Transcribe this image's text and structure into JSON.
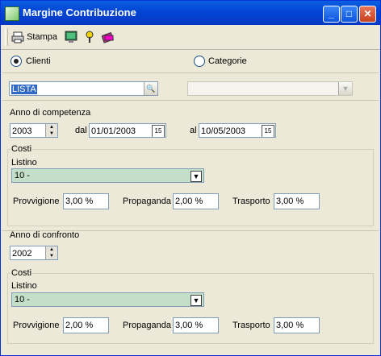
{
  "window": {
    "title": "Margine Contribuzione"
  },
  "toolbar": {
    "print_label": "Stampa"
  },
  "mode": {
    "clienti_label": "Clienti",
    "categorie_label": "Categorie",
    "selected": "Clienti"
  },
  "search": {
    "value": "LISTA"
  },
  "competenza": {
    "group_label": "Anno di competenza",
    "year": "2003",
    "dal_label": "dal",
    "dal_value": "01/01/2003",
    "al_label": "al",
    "al_value": "10/05/2003",
    "costi_label": "Costi",
    "listino_label": "Listino",
    "listino_value": "10 -",
    "provvigione_label": "Provvigione",
    "provvigione_value": "3,00 %",
    "propaganda_label": "Propaganda",
    "propaganda_value": "2,00 %",
    "trasporto_label": "Trasporto",
    "trasporto_value": "3,00 %"
  },
  "confronto": {
    "group_label": "Anno di confronto",
    "year": "2002",
    "costi_label": "Costi",
    "listino_label": "Listino",
    "listino_value": "10 -",
    "provvigione_label": "Provvigione",
    "provvigione_value": "2,00 %",
    "propaganda_label": "Propaganda",
    "propaganda_value": "3,00 %",
    "trasporto_label": "Trasporto",
    "trasporto_value": "3,00 %"
  },
  "colors": {
    "titlebar": "#0347d6",
    "selection": "#316ac5",
    "combo_bg": "#c3dfc8"
  },
  "icons": [
    "printer-icon",
    "monitor-icon",
    "help-icon",
    "books-icon",
    "search-icon",
    "calendar-icon"
  ]
}
